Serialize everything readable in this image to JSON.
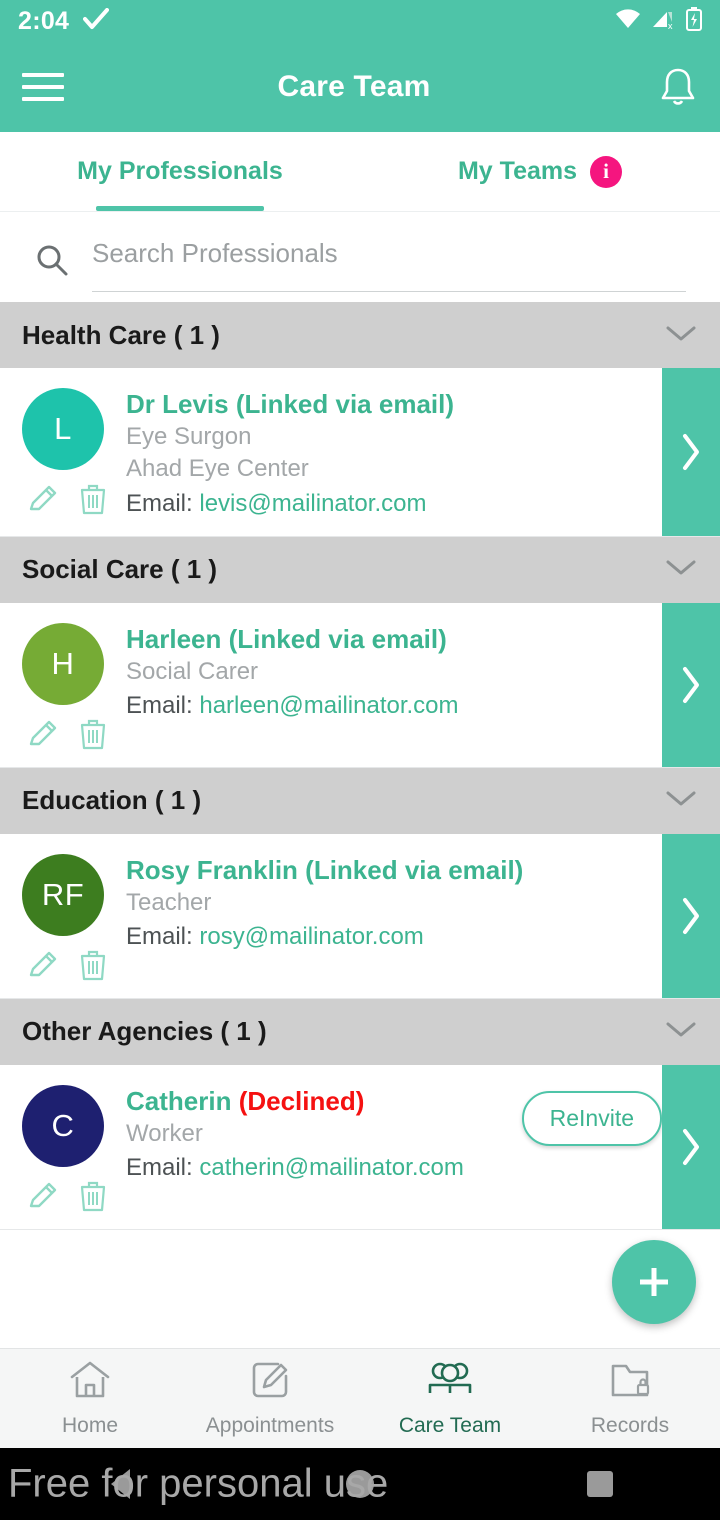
{
  "status_bar": {
    "time": "2:04",
    "check_icon": "checkmark-icon",
    "wifi_icon": "wifi-icon",
    "signal_icon": "cellular-no-sim-icon",
    "battery_icon": "battery-charging-icon"
  },
  "app_bar": {
    "menu_icon": "hamburger-menu-icon",
    "title": "Care Team",
    "notification_icon": "bell-icon"
  },
  "tabs": [
    {
      "label": "My Professionals",
      "active": true
    },
    {
      "label": "My Teams",
      "active": false,
      "info_icon": "info-icon",
      "info_glyph": "i"
    }
  ],
  "search": {
    "icon": "search-icon",
    "placeholder": "Search Professionals",
    "value": ""
  },
  "sections": [
    {
      "title": "Health Care ( 1 )",
      "chevron_icon": "chevron-down-icon",
      "members": [
        {
          "avatar_initials": "L",
          "avatar_color": "#1ec3ab",
          "name": "Dr Levis (Linked via email)",
          "status": "",
          "role": "Eye Surgon",
          "organization": "Ahad Eye Center",
          "email_label": "Email: ",
          "email": "levis@mailinator.com",
          "edit_icon": "pencil-edit-icon",
          "delete_icon": "trash-delete-icon",
          "arrow_icon": "chevron-right-icon",
          "reinvite_label": ""
        }
      ]
    },
    {
      "title": "Social Care ( 1 )",
      "chevron_icon": "chevron-down-icon",
      "members": [
        {
          "avatar_initials": "H",
          "avatar_color": "#76ab35",
          "name": "Harleen (Linked via email)",
          "status": "",
          "role": "Social Carer",
          "organization": "",
          "email_label": "Email: ",
          "email": "harleen@mailinator.com",
          "edit_icon": "pencil-edit-icon",
          "delete_icon": "trash-delete-icon",
          "arrow_icon": "chevron-right-icon",
          "reinvite_label": ""
        }
      ]
    },
    {
      "title": "Education ( 1 )",
      "chevron_icon": "chevron-down-icon",
      "members": [
        {
          "avatar_initials": "RF",
          "avatar_color": "#3d7d1f",
          "name": "Rosy Franklin (Linked via email)",
          "status": "",
          "role": "Teacher",
          "organization": "",
          "email_label": "Email: ",
          "email": "rosy@mailinator.com",
          "edit_icon": "pencil-edit-icon",
          "delete_icon": "trash-delete-icon",
          "arrow_icon": "chevron-right-icon",
          "reinvite_label": ""
        }
      ]
    },
    {
      "title": "Other Agencies ( 1 )",
      "chevron_icon": "chevron-down-icon",
      "members": [
        {
          "avatar_initials": "C",
          "avatar_color": "#1e2070",
          "name": "Catherin ",
          "status": "(Declined)",
          "role": "Worker",
          "organization": "",
          "email_label": "Email: ",
          "email": "catherin@mailinator.com",
          "edit_icon": "pencil-edit-icon",
          "delete_icon": "trash-delete-icon",
          "arrow_icon": "chevron-right-icon",
          "reinvite_label": "ReInvite"
        }
      ]
    }
  ],
  "fab": {
    "icon": "plus-icon",
    "label": "+"
  },
  "bottom_nav": [
    {
      "label": "Home",
      "icon": "home-icon",
      "active": false
    },
    {
      "label": "Appointments",
      "icon": "pencil-note-icon",
      "active": false
    },
    {
      "label": "Care Team",
      "icon": "people-group-icon",
      "active": true
    },
    {
      "label": "Records",
      "icon": "folder-lock-icon",
      "active": false
    }
  ],
  "android_nav": {
    "back_icon": "back-triangle-icon",
    "home_icon": "home-circle-icon",
    "recents_icon": "recents-square-icon",
    "watermark": "Free for personal use"
  },
  "colors": {
    "brand_teal": "#4ec4a8",
    "accent_pink": "#f5157f",
    "declined_red": "#f51111",
    "section_gray": "#cfcfcf",
    "active_nav_green": "#226b52"
  }
}
